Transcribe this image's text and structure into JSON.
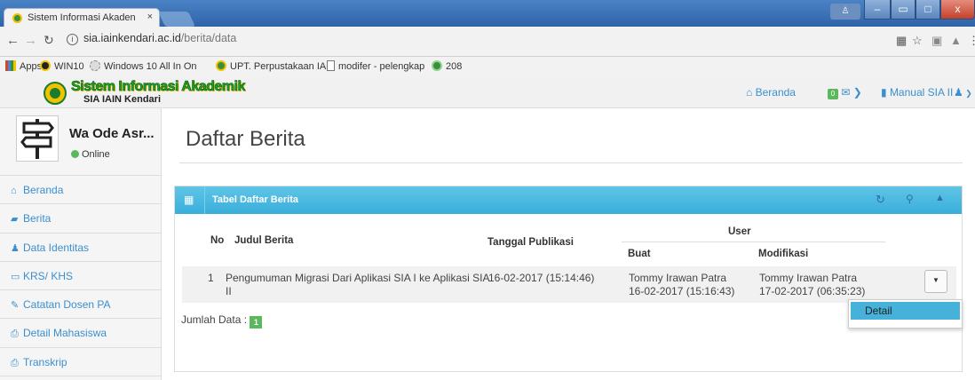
{
  "browser": {
    "tab_title": "Sistem Informasi Akaden",
    "tab_close": "×",
    "window_controls": {
      "minimize": "–",
      "restore": "▭",
      "maximize": "□",
      "close": "x"
    },
    "url_host": "sia.iainkendari.ac.id",
    "url_path": "/berita/data",
    "bookmarks": [
      {
        "label": "Apps",
        "color": "#d04a2a"
      },
      {
        "label": "WIN10",
        "color": "#2a2a2a"
      },
      {
        "label": "Windows 10 All In On",
        "color": "#aaaaaa"
      },
      {
        "label": "UPT. Perpustakaan IAI",
        "color": "#3a8f3a"
      },
      {
        "label": "modifer - pelengkap",
        "color": "#ffffff"
      },
      {
        "label": "208",
        "color": "#3a8f3a"
      }
    ]
  },
  "site": {
    "brand": "Sistem Informasi Akademik",
    "brand_sub": "SIA IAIN Kendari",
    "nav": {
      "beranda": "Beranda",
      "badge": "0",
      "manual": "Manual SIA II"
    }
  },
  "sidebar": {
    "user_name": "Wa Ode Asr...",
    "status": "Online",
    "items": [
      {
        "icon": "home-icon",
        "glyph": "⌂",
        "label": "Beranda"
      },
      {
        "icon": "book-icon",
        "glyph": "▰",
        "label": "Berita"
      },
      {
        "icon": "user-icon",
        "glyph": "♟",
        "label": "Data Identitas"
      },
      {
        "icon": "folder-icon",
        "glyph": "▭",
        "label": "KRS/ KHS"
      },
      {
        "icon": "edit-icon",
        "glyph": "✎",
        "label": "Catatan Dosen PA"
      },
      {
        "icon": "print-icon",
        "glyph": "⎙",
        "label": "Detail Mahasiswa"
      },
      {
        "icon": "print-icon",
        "glyph": "⎙",
        "label": "Transkrip"
      }
    ]
  },
  "main": {
    "page_title": "Daftar Berita",
    "panel_title": "Tabel Daftar Berita",
    "columns": {
      "no": "No",
      "judul": "Judul Berita",
      "tanggal": "Tanggal Publikasi",
      "user": "User",
      "buat": "Buat",
      "modifikasi": "Modifikasi"
    },
    "rows": [
      {
        "no": "1",
        "judul_line1": "Pengumuman Migrasi Dari Aplikasi SIA I ke Aplikasi SIA",
        "judul_line2": "II",
        "tanggal": "16-02-2017 (15:14:46)",
        "buat_name": "Tommy Irawan Patra",
        "buat_date": "16-02-2017 (15:16:43)",
        "mod_name": "Tommy Irawan Patra",
        "mod_date": "17-02-2017 (06:35:23)"
      }
    ],
    "dropdown_item": "Detail",
    "jumlah_label": "Jumlah Data :",
    "jumlah_value": "1"
  }
}
